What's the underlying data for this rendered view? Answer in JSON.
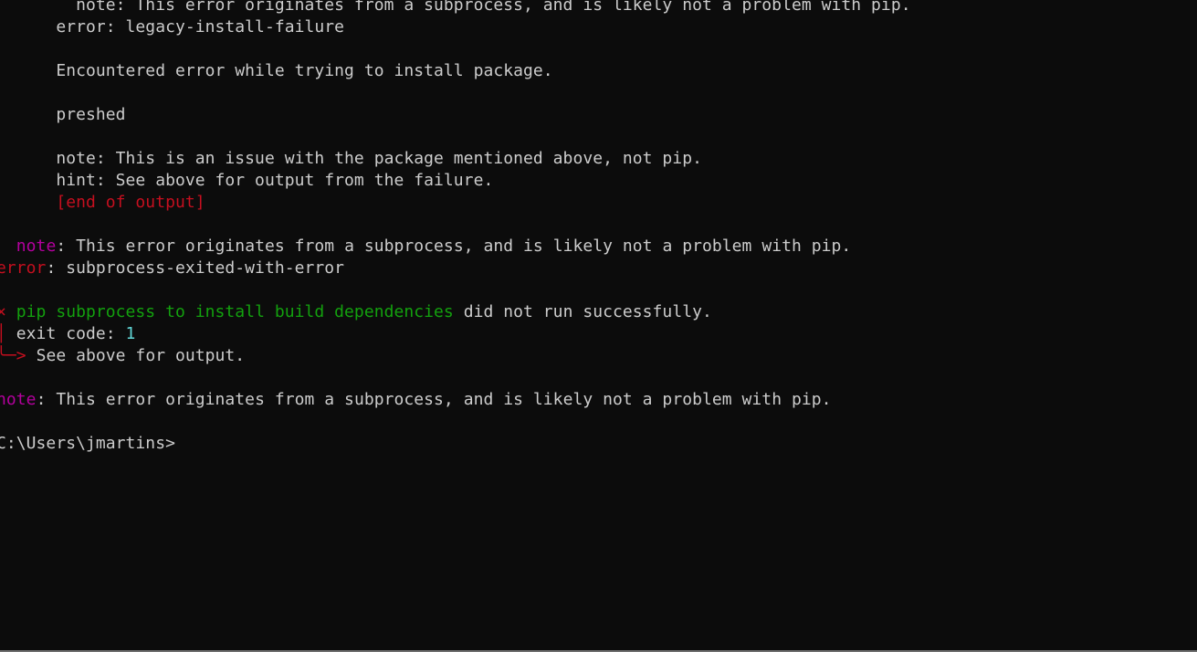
{
  "terminal": {
    "colors": {
      "background": "#0c0c0c",
      "default": "#cccccc",
      "red": "#c50f1f",
      "green": "#13a10e",
      "magenta": "#b4009e",
      "cyan": "#61d6d6"
    },
    "lines": [
      {
        "segments": [
          {
            "text": "        note: This error originates from a subprocess, and is likely not a problem with pip.",
            "color": "default"
          }
        ]
      },
      {
        "segments": [
          {
            "text": "      error: legacy-install-failure",
            "color": "default"
          }
        ]
      },
      {
        "segments": []
      },
      {
        "segments": [
          {
            "text": "      Encountered error while trying to install package.",
            "color": "default"
          }
        ]
      },
      {
        "segments": []
      },
      {
        "segments": [
          {
            "text": "      preshed",
            "color": "default"
          }
        ]
      },
      {
        "segments": []
      },
      {
        "segments": [
          {
            "text": "      note: This is an issue with the package mentioned above, not pip.",
            "color": "default"
          }
        ]
      },
      {
        "segments": [
          {
            "text": "      hint: See above for output from the failure.",
            "color": "default"
          }
        ]
      },
      {
        "segments": [
          {
            "text": "      ",
            "color": "default"
          },
          {
            "text": "[end of output]",
            "color": "red"
          }
        ]
      },
      {
        "segments": []
      },
      {
        "segments": [
          {
            "text": "  ",
            "color": "default"
          },
          {
            "text": "note",
            "color": "magenta"
          },
          {
            "text": ": This error originates from a subprocess, and is likely not a problem with pip.",
            "color": "default"
          }
        ]
      },
      {
        "segments": [
          {
            "text": "error",
            "color": "red"
          },
          {
            "text": ": subprocess-exited-with-error",
            "color": "default"
          }
        ]
      },
      {
        "segments": []
      },
      {
        "segments": [
          {
            "text": "× ",
            "color": "red"
          },
          {
            "text": "pip subprocess to install build dependencies",
            "color": "green"
          },
          {
            "text": " did not run successfully.",
            "color": "default"
          }
        ]
      },
      {
        "segments": [
          {
            "text": "│ ",
            "color": "red"
          },
          {
            "text": "exit code: ",
            "color": "default"
          },
          {
            "text": "1",
            "color": "cyan"
          }
        ]
      },
      {
        "segments": [
          {
            "text": "╰─> ",
            "color": "red"
          },
          {
            "text": "See above for output.",
            "color": "default"
          }
        ]
      },
      {
        "segments": []
      },
      {
        "segments": [
          {
            "text": "note",
            "color": "magenta"
          },
          {
            "text": ": This error originates from a subprocess, and is likely not a problem with pip.",
            "color": "default"
          }
        ]
      },
      {
        "segments": []
      },
      {
        "segments": [
          {
            "text": "C:\\Users\\jmartins>",
            "color": "default"
          }
        ]
      }
    ]
  }
}
